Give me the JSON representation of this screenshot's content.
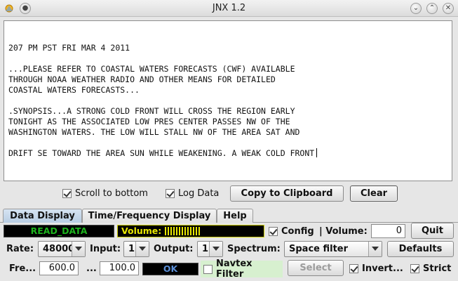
{
  "window": {
    "title": "JNX 1.2"
  },
  "log_lines": [
    "",
    "207 PM PST FRI MAR 4 2011",
    "",
    "...PLEASE REFER TO COASTAL WATERS FORECASTS (CWF) AVAILABLE",
    "THROUGH NOAA WEATHER RADIO AND OTHER MEANS FOR DETAILED",
    "COASTAL WATERS FORECASTS...",
    "",
    ".SYNOPSIS...A STRONG COLD FRONT WILL CROSS THE REGION EARLY",
    "TONIGHT AS THE ASSOCIATED LOW PRES CENTER PASSES NW OF THE",
    "WASHINGTON WATERS. THE LOW WILL STALL NW OF THE AREA SAT AND",
    "",
    "DRIFT SE TOWARD THE AREA SUN WHILE WEAKENING. A WEAK COLD FRONT"
  ],
  "controls": {
    "scroll_to_bottom": {
      "label": "Scroll to bottom",
      "checked": true
    },
    "log_data": {
      "label": "Log Data",
      "checked": true
    },
    "copy_label": "Copy to Clipboard",
    "clear_label": "Clear"
  },
  "tabs": [
    {
      "label": "Data Display",
      "active": true
    },
    {
      "label": "Time/Frequency Display",
      "active": false
    },
    {
      "label": "Help",
      "active": false
    }
  ],
  "status": {
    "mode": "READ_DATA",
    "mode_color": "#1db41d",
    "volume_label": "Volume:",
    "volume_color": "#e7e700",
    "volume_level": 0.5
  },
  "config": {
    "label": "Config",
    "checked": true
  },
  "volume": {
    "label": "| Volume:",
    "value": "0"
  },
  "quit_label": "Quit",
  "rate": {
    "label": "Rate:",
    "value": "48000"
  },
  "input": {
    "label": "Input:",
    "value": "1"
  },
  "output": {
    "label": "Output:",
    "value": "1"
  },
  "spectrum": {
    "label": "Spectrum:",
    "value": "Space filter"
  },
  "defaults_label": "Defaults",
  "freq": {
    "label": "Fre...",
    "value": "600.0"
  },
  "bw": {
    "label": "...",
    "value": "100.0"
  },
  "ok_status": {
    "text": "OK",
    "color": "#5b8fd8"
  },
  "navtex": {
    "label": "Navtex Filter",
    "checked": false
  },
  "select_label": "Select",
  "invert": {
    "label": "Invert...",
    "checked": true
  },
  "strict": {
    "label": "Strict",
    "checked": true
  }
}
